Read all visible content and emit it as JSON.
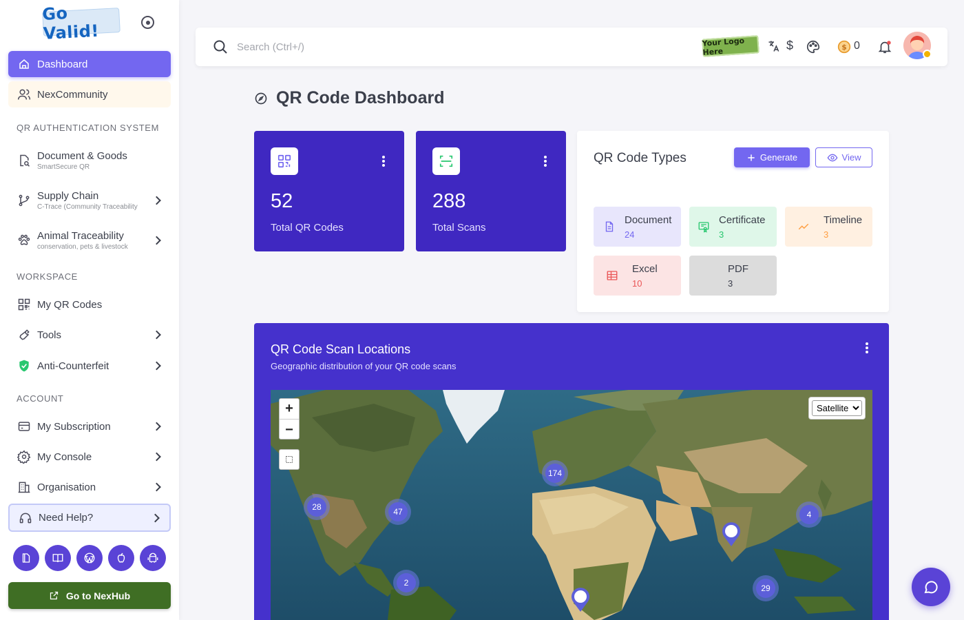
{
  "brand": {
    "logo_text": "Go Valid!"
  },
  "sidebar": {
    "dashboard": "Dashboard",
    "community": "NexCommunity",
    "section_qr": "QR AUTHENTICATION SYSTEM",
    "doc_goods": {
      "label": "Document & Goods",
      "sub": "SmartSecure QR"
    },
    "supply_chain": {
      "label": "Supply Chain",
      "sub": "C-Trace (Community Traceability"
    },
    "animal": {
      "label": "Animal Traceability",
      "sub": "conservation, pets & livestock"
    },
    "section_workspace": "WORKSPACE",
    "my_qr": "My QR Codes",
    "tools": "Tools",
    "anti_counterfeit": "Anti-Counterfeit",
    "section_account": "ACCOUNT",
    "subscription": "My Subscription",
    "console": "My Console",
    "organisation": "Organisation",
    "help": "Need Help?",
    "nexhub": "Go to NexHub"
  },
  "topbar": {
    "search_placeholder": "Search (Ctrl+/)",
    "your_logo": "Your Logo Here",
    "currency_symbol": "$",
    "coin_count": "0"
  },
  "page": {
    "title": "QR Code Dashboard"
  },
  "stats": {
    "total_qr": {
      "value": "52",
      "label": "Total QR Codes"
    },
    "total_scans": {
      "value": "288",
      "label": "Total Scans"
    }
  },
  "qr_types": {
    "title": "QR Code Types",
    "generate": "Generate",
    "view": "View",
    "items": [
      {
        "name": "Document",
        "count": "24",
        "color": "#7367f0",
        "bg": "#e8e6fc"
      },
      {
        "name": "Certificate",
        "count": "3",
        "color": "#28c76f",
        "bg": "#dff7e9"
      },
      {
        "name": "Timeline",
        "count": "3",
        "color": "#ff9f43",
        "bg": "#fff0e1"
      },
      {
        "name": "Excel",
        "count": "10",
        "color": "#ea5455",
        "bg": "#fce4e4"
      },
      {
        "name": "PDF",
        "count": "3",
        "color": "#3b3f4b",
        "bg": "#dcdcdc"
      }
    ]
  },
  "map": {
    "title": "QR Code Scan Locations",
    "subtitle": "Geographic distribution of your QR code scans",
    "zoom_in": "+",
    "zoom_out": "−",
    "layer": "Satellite",
    "clusters": [
      "28",
      "47",
      "174",
      "4",
      "2",
      "29"
    ]
  },
  "colors": {
    "accent": "#7367f0",
    "primary_dark": "#3f28c1",
    "nexhub_green": "#3f6e24"
  }
}
